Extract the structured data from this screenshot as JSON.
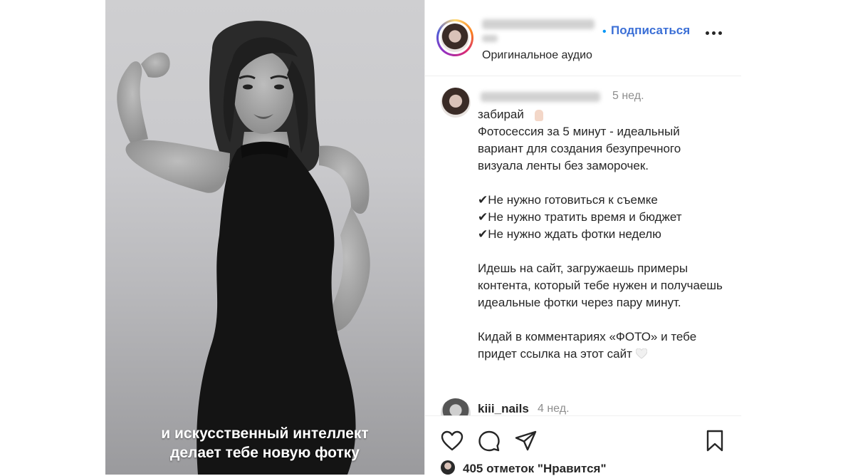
{
  "media": {
    "caption_line1": "и искусственный интеллект",
    "caption_line2": "делает тебе новую фотку"
  },
  "header": {
    "separator": "•",
    "follow_label": "Подписаться",
    "audio_label": "Оригинальное аудио"
  },
  "post": {
    "time": "5 нед.",
    "text": "забирай\nФотосессия за 5 минут - идеальный вариант для создания безупречного визуала ленты без заморочек.\n\n✔Не нужно готовиться к съемке\n✔Не нужно тратить время и бюджет\n✔Не нужно ждать фотки неделю\n\nИдешь на сайт, загружаешь примеры контента, который тебе нужен и получаешь идеальные фотки через пару минут.\n\nКидай в комментариях «ФОТО» и тебе придет ссылка на этот сайт"
  },
  "comment": {
    "username": "kiii_nails",
    "time": "4 нед."
  },
  "footer": {
    "likes": "405 отметок \"Нравится\""
  },
  "icons": [
    "heart-icon",
    "comment-icon",
    "share-icon",
    "bookmark-icon",
    "more-icon"
  ],
  "colors": {
    "follow": "#3b6fd6",
    "secondary_text": "#8e8e8e",
    "text": "#262626"
  }
}
